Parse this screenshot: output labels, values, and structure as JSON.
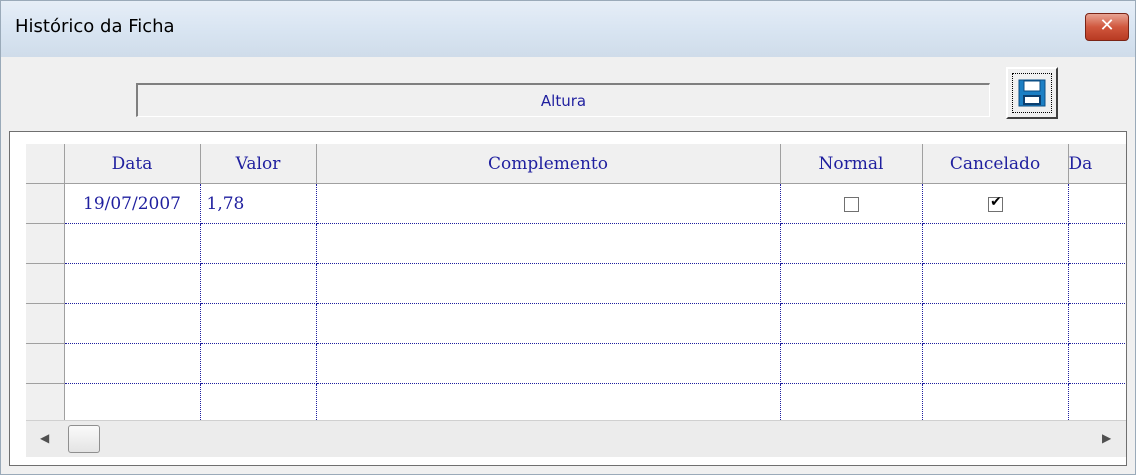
{
  "window": {
    "title": "Histórico da Ficha",
    "close_label": "✕"
  },
  "field": {
    "value": "Altura"
  },
  "grid": {
    "headers": [
      "Data",
      "Valor",
      "Complemento",
      "Normal",
      "Cancelado",
      "Da"
    ],
    "rows": [
      {
        "data": "19/07/2007",
        "valor": "1,78",
        "complemento": "",
        "normal": false,
        "cancelado": true
      },
      {
        "data": "",
        "valor": "",
        "complemento": ""
      },
      {
        "data": "",
        "valor": "",
        "complemento": ""
      },
      {
        "data": "",
        "valor": "",
        "complemento": ""
      },
      {
        "data": "",
        "valor": "",
        "complemento": ""
      },
      {
        "data": "",
        "valor": "",
        "complemento": ""
      }
    ]
  },
  "scrollbar": {
    "left_arrow": "◀",
    "right_arrow": "▶"
  },
  "checkbox_mark": "✔",
  "icons": {
    "save": "save-icon",
    "close": "close-icon"
  },
  "colors": {
    "grid_text": "#1f1f9f",
    "close_button": "#c9503a"
  }
}
